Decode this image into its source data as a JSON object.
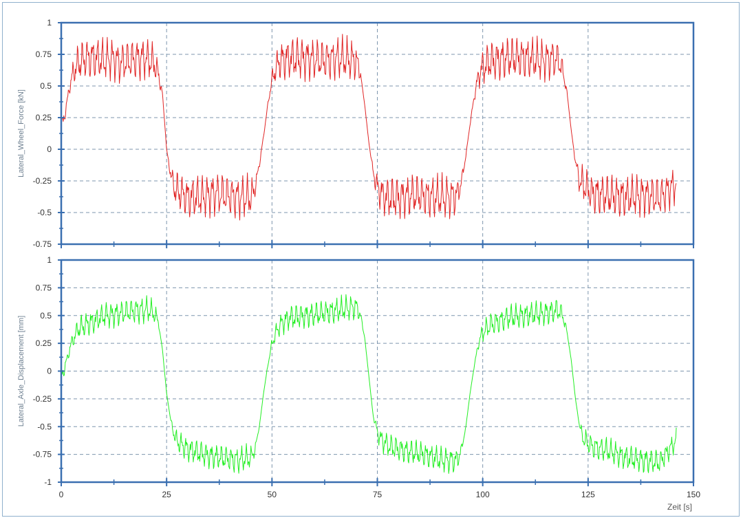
{
  "chart_data": [
    {
      "type": "line",
      "title": "",
      "xlabel": "",
      "ylabel": "Lateral_Wheel_Force [kN]",
      "xlim": [
        0,
        150
      ],
      "ylim": [
        -0.75,
        1
      ],
      "x_ticks": [
        "0",
        "25",
        "50",
        "75",
        "100",
        "125",
        "150"
      ],
      "y_ticks": [
        "1",
        "0.75",
        "0.5",
        "0.25",
        "0",
        "-0.25",
        "-0.5",
        "-0.75"
      ],
      "grid": true,
      "color": "#e02424",
      "series": [
        {
          "x": [
            0,
            1,
            2,
            3,
            4,
            5,
            6,
            8,
            10,
            12,
            14,
            16,
            18,
            20,
            21,
            22,
            23,
            24,
            25,
            26,
            27,
            30,
            33,
            36,
            39,
            42,
            45,
            46,
            47,
            48,
            49,
            50,
            51,
            52,
            54,
            58,
            62,
            66,
            70,
            71,
            72,
            73,
            74,
            75,
            76,
            77,
            80,
            84,
            88,
            92,
            94,
            95,
            96,
            97,
            98,
            99,
            100,
            102,
            106,
            110,
            114,
            117,
            118,
            119,
            120,
            121,
            122,
            123,
            126,
            130,
            134,
            138,
            142,
            146
          ],
          "values": [
            0.15,
            0.3,
            0.5,
            0.62,
            0.68,
            0.7,
            0.72,
            0.72,
            0.7,
            0.72,
            0.68,
            0.7,
            0.72,
            0.72,
            0.7,
            0.68,
            0.6,
            0.45,
            0.0,
            -0.2,
            -0.32,
            -0.38,
            -0.38,
            -0.35,
            -0.36,
            -0.38,
            -0.38,
            -0.3,
            -0.12,
            0.1,
            0.35,
            0.55,
            0.65,
            0.7,
            0.72,
            0.72,
            0.7,
            0.72,
            0.7,
            0.6,
            0.35,
            0.05,
            -0.18,
            -0.3,
            -0.35,
            -0.38,
            -0.38,
            -0.36,
            -0.38,
            -0.38,
            -0.36,
            -0.25,
            -0.05,
            0.2,
            0.42,
            0.58,
            0.65,
            0.7,
            0.72,
            0.72,
            0.7,
            0.72,
            0.7,
            0.62,
            0.45,
            0.15,
            -0.1,
            -0.25,
            -0.35,
            -0.37,
            -0.38,
            -0.36,
            -0.38,
            -0.27
          ]
        }
      ]
    },
    {
      "type": "line",
      "title": "",
      "xlabel": "Zeit [s]",
      "ylabel": "Lateral_Axle_Displacement [mm]",
      "xlim": [
        0,
        150
      ],
      "ylim": [
        -1,
        1
      ],
      "x_ticks": [
        "0",
        "25",
        "50",
        "75",
        "100",
        "125",
        "150"
      ],
      "y_ticks": [
        "1",
        "0.75",
        "0.5",
        "0.25",
        "0",
        "-0.25",
        "-0.5",
        "-0.75",
        "-1"
      ],
      "grid": true,
      "color": "#22ee22",
      "series": [
        {
          "x": [
            0,
            1,
            2,
            3,
            4,
            6,
            8,
            10,
            14,
            18,
            21,
            22,
            23,
            24,
            25,
            26,
            27,
            28,
            30,
            34,
            38,
            42,
            45,
            46,
            47,
            48,
            49,
            50,
            51,
            52,
            54,
            58,
            62,
            66,
            70,
            71,
            72,
            73,
            74,
            75,
            76,
            78,
            82,
            86,
            90,
            94,
            95,
            96,
            97,
            98,
            99,
            100,
            102,
            106,
            110,
            114,
            118,
            119,
            120,
            121,
            122,
            123,
            124,
            126,
            130,
            134,
            138,
            142,
            146
          ],
          "values": [
            -0.05,
            0.05,
            0.2,
            0.3,
            0.38,
            0.42,
            0.45,
            0.5,
            0.52,
            0.55,
            0.55,
            0.52,
            0.45,
            0.2,
            -0.2,
            -0.45,
            -0.6,
            -0.65,
            -0.7,
            -0.75,
            -0.78,
            -0.8,
            -0.78,
            -0.7,
            -0.5,
            -0.2,
            0.05,
            0.25,
            0.35,
            0.42,
            0.48,
            0.5,
            0.52,
            0.55,
            0.58,
            0.5,
            0.3,
            -0.05,
            -0.4,
            -0.55,
            -0.62,
            -0.68,
            -0.72,
            -0.75,
            -0.8,
            -0.8,
            -0.7,
            -0.5,
            -0.2,
            0.05,
            0.25,
            0.35,
            0.42,
            0.48,
            0.5,
            0.52,
            0.55,
            0.5,
            0.35,
            0.1,
            -0.25,
            -0.5,
            -0.62,
            -0.68,
            -0.72,
            -0.78,
            -0.8,
            -0.82,
            -0.62
          ]
        }
      ]
    }
  ]
}
